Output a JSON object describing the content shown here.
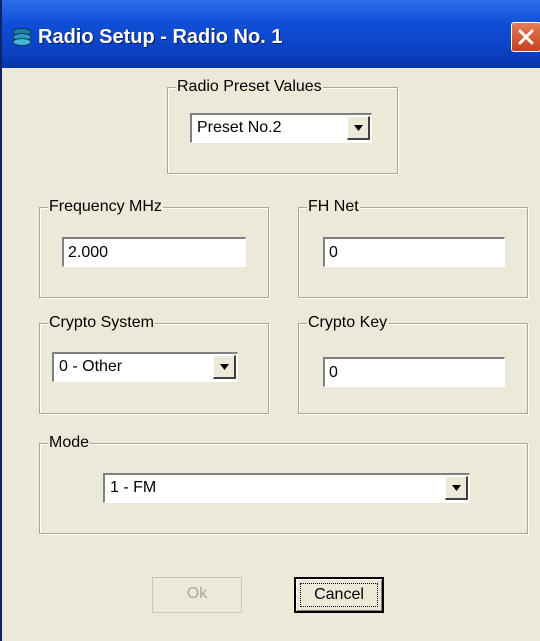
{
  "window": {
    "title": "Radio Setup - Radio No. 1",
    "icon": "radio-icon",
    "close_icon": "close-icon"
  },
  "preset": {
    "label": "Radio Preset Values",
    "value": "Preset No.2"
  },
  "frequency": {
    "label": "Frequency MHz",
    "value": "2.000"
  },
  "fh_net": {
    "label": "FH Net",
    "value": "0"
  },
  "crypto_system": {
    "label": "Crypto System",
    "value": "0 - Other"
  },
  "crypto_key": {
    "label": "Crypto Key",
    "value": "0"
  },
  "mode": {
    "label": "Mode",
    "value": "1 - FM"
  },
  "buttons": {
    "ok": "Ok",
    "cancel": "Cancel"
  },
  "colors": {
    "titlebar": "#0A3FC0",
    "dialog_bg": "#ECE9D8",
    "close_button": "#C5401F"
  }
}
